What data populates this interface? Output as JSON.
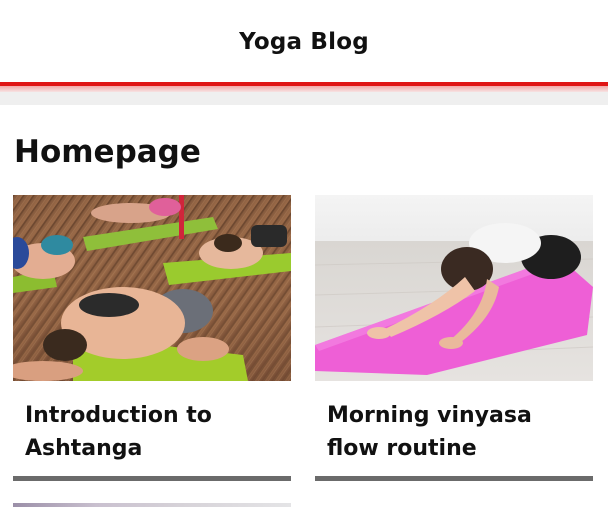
{
  "header": {
    "site_title": "Yoga Blog",
    "accent_color": "#e01515"
  },
  "main": {
    "page_title": "Homepage",
    "posts": [
      {
        "title": "Introduction to\nAshtanga",
        "image": "yoga-class-childs-pose-photo"
      },
      {
        "title": "Morning vinyasa\nflow routine",
        "image": "woman-on-pink-mat-photo"
      }
    ]
  }
}
